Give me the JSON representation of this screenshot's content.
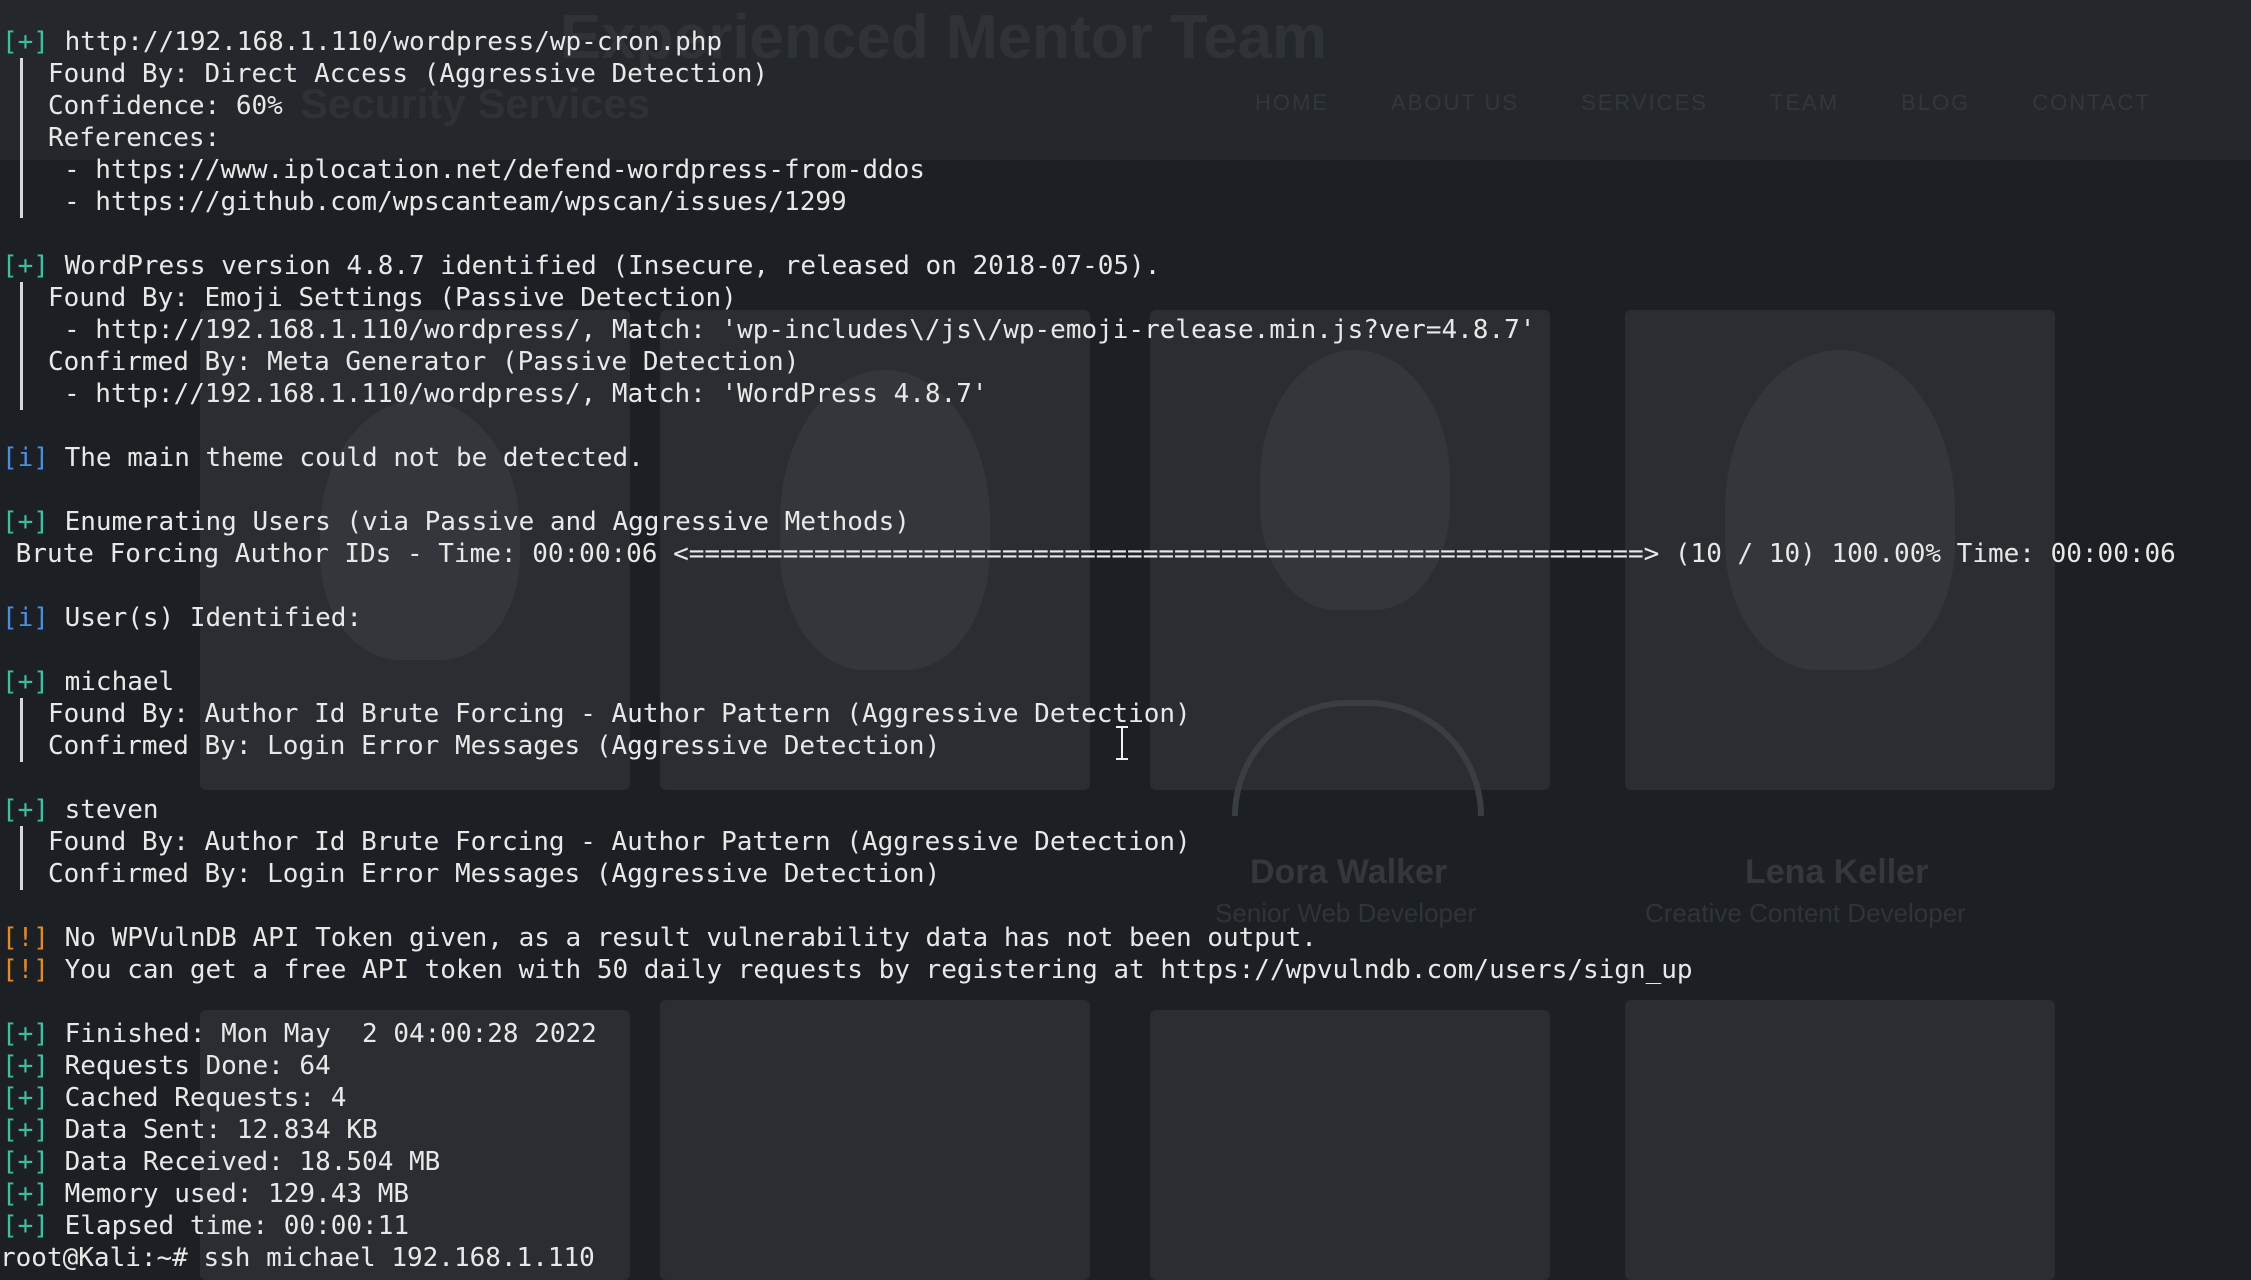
{
  "background_site": {
    "title": "Experienced Mentor Team",
    "subtitle": "Security Services",
    "nav": [
      "HOME",
      "ABOUT US",
      "SERVICES",
      "TEAM",
      "BLOG",
      "CONTACT"
    ],
    "cards": [
      {
        "name": "",
        "role": ""
      },
      {
        "name": "",
        "role": ""
      },
      {
        "name": "Dora Walker",
        "role": "Senior Web Developer"
      },
      {
        "name": "Lena Keller",
        "role": "Creative Content Developer"
      }
    ]
  },
  "terminal": {
    "lines": [
      {
        "tag": "[+]",
        "tag_color": "green",
        "text": " http://192.168.1.110/wordpress/wp-cron.php"
      },
      {
        "bar": true,
        "indent": 1,
        "text": "Found By: Direct Access (Aggressive Detection)"
      },
      {
        "bar": true,
        "indent": 1,
        "text": "Confidence: 60%"
      },
      {
        "bar": true,
        "indent": 1,
        "text": "References:"
      },
      {
        "bar": true,
        "indent": 2,
        "text": "- https://www.iplocation.net/defend-wordpress-from-ddos"
      },
      {
        "bar": true,
        "indent": 2,
        "text": "- https://github.com/wpscanteam/wpscan/issues/1299"
      },
      {
        "blank": true
      },
      {
        "tag": "[+]",
        "tag_color": "green",
        "text": " WordPress version 4.8.7 identified (Insecure, released on 2018-07-05)."
      },
      {
        "bar": true,
        "indent": 1,
        "text": "Found By: Emoji Settings (Passive Detection)"
      },
      {
        "bar": true,
        "indent": 2,
        "text": "- http://192.168.1.110/wordpress/, Match: 'wp-includes\\/js\\/wp-emoji-release.min.js?ver=4.8.7'"
      },
      {
        "bar": true,
        "indent": 1,
        "text": "Confirmed By: Meta Generator (Passive Detection)"
      },
      {
        "bar": true,
        "indent": 2,
        "text": "- http://192.168.1.110/wordpress/, Match: 'WordPress 4.8.7'"
      },
      {
        "blank": true
      },
      {
        "tag": "[i]",
        "tag_color": "blue",
        "text": " The main theme could not be detected."
      },
      {
        "blank": true
      },
      {
        "tag": "[+]",
        "tag_color": "green",
        "text": " Enumerating Users (via Passive and Aggressive Methods)"
      },
      {
        "plain": true,
        "text": " Brute Forcing Author IDs - Time: 00:00:06 <=============================================================> (10 / 10) 100.00% Time: 00:00:06"
      },
      {
        "blank": true
      },
      {
        "tag": "[i]",
        "tag_color": "blue",
        "text": " User(s) Identified:"
      },
      {
        "blank": true
      },
      {
        "tag": "[+]",
        "tag_color": "green",
        "text": " michael"
      },
      {
        "bar": true,
        "indent": 1,
        "text": "Found By: Author Id Brute Forcing - Author Pattern (Aggressive Detection)"
      },
      {
        "bar": true,
        "indent": 1,
        "text": "Confirmed By: Login Error Messages (Aggressive Detection)"
      },
      {
        "blank": true
      },
      {
        "tag": "[+]",
        "tag_color": "green",
        "text": " steven"
      },
      {
        "bar": true,
        "indent": 1,
        "text": "Found By: Author Id Brute Forcing - Author Pattern (Aggressive Detection)"
      },
      {
        "bar": true,
        "indent": 1,
        "text": "Confirmed By: Login Error Messages (Aggressive Detection)"
      },
      {
        "blank": true
      },
      {
        "tag": "[!]",
        "tag_color": "orange",
        "text": " No WPVulnDB API Token given, as a result vulnerability data has not been output."
      },
      {
        "tag": "[!]",
        "tag_color": "orange",
        "text": " You can get a free API token with 50 daily requests by registering at https://wpvulndb.com/users/sign_up"
      },
      {
        "blank": true
      },
      {
        "tag": "[+]",
        "tag_color": "green",
        "text": " Finished: Mon May  2 04:00:28 2022"
      },
      {
        "tag": "[+]",
        "tag_color": "green",
        "text": " Requests Done: 64"
      },
      {
        "tag": "[+]",
        "tag_color": "green",
        "text": " Cached Requests: 4"
      },
      {
        "tag": "[+]",
        "tag_color": "green",
        "text": " Data Sent: 12.834 KB"
      },
      {
        "tag": "[+]",
        "tag_color": "green",
        "text": " Data Received: 18.504 MB"
      },
      {
        "tag": "[+]",
        "tag_color": "green",
        "text": " Memory used: 129.43 MB"
      },
      {
        "tag": "[+]",
        "tag_color": "green",
        "text": " Elapsed time: 00:00:11"
      },
      {
        "plain": true,
        "text": "root@Kali:~# ssh michael 192.168.1.110"
      }
    ]
  },
  "colors": {
    "terminal_bg": "#1c2024",
    "text": "#e8e8e8",
    "tag_green": "#3fbf9f",
    "tag_blue": "#4a8fd8",
    "tag_orange": "#e08a2c"
  }
}
